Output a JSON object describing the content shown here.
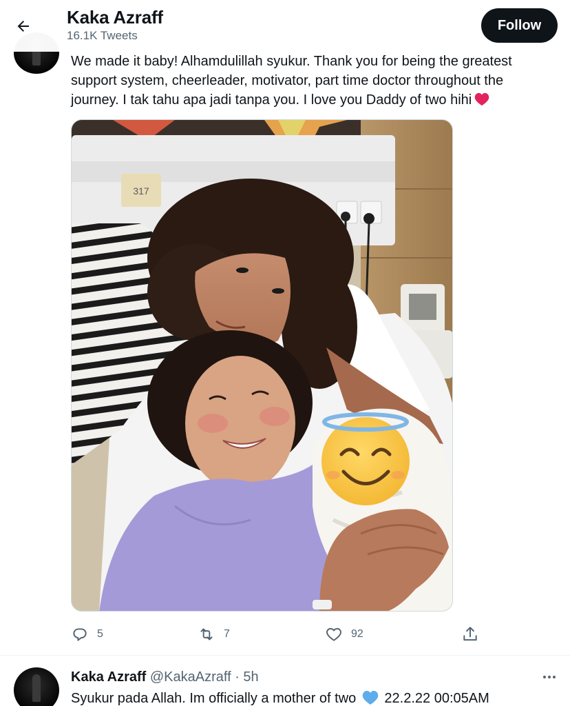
{
  "header": {
    "title": "Kaka Azraff",
    "tweet_count": "16.1K Tweets",
    "follow_label": "Follow"
  },
  "tweet1": {
    "text": "We made it baby! Alhamdulillah syukur. Thank you for being the greatest support system, cheerleader, motivator, part time doctor throughout the journey. I tak tahu apa jadi tanpa you. I love you Daddy of two hihi",
    "emoji": "red-heart",
    "photo": {
      "room_number": "317",
      "baby_face_emoji": "smiling-face-with-halo"
    },
    "stats": {
      "replies": "5",
      "retweets": "7",
      "likes": "92"
    }
  },
  "tweet2": {
    "name": "Kaka Azraff",
    "handle": "@KakaAzraff",
    "separator": "·",
    "time": "5h",
    "text_before": "Syukur pada Allah. Im officially a mother of two",
    "emoji": "blue-heart",
    "text_after": "22.2.22 00:05AM"
  },
  "colors": {
    "text_primary": "#0f1419",
    "text_secondary": "#536471",
    "follow_bg": "#0f1419",
    "heart_red": "#e0245e",
    "heart_blue": "#5dadec"
  }
}
